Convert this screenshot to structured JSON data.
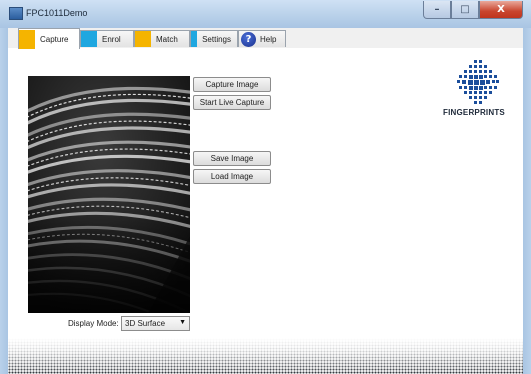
{
  "window": {
    "title": "FPC1011Demo",
    "controls": {
      "minimize": "–",
      "maximize": "□",
      "close": "X"
    }
  },
  "tabs": [
    {
      "label": "Capture",
      "color": "#f5b400",
      "active": true
    },
    {
      "label": "Enrol",
      "color": "#1fa7e0",
      "active": false
    },
    {
      "label": "Match",
      "color": "#f5b400",
      "active": false
    },
    {
      "label": "Settings",
      "color": "#1fa7e0",
      "active": false
    },
    {
      "label": "Help",
      "icon": "help-icon",
      "active": false
    }
  ],
  "buttons": {
    "capture_image": "Capture Image",
    "start_live_capture": "Start Live Capture",
    "save_image": "Save Image",
    "load_image": "Load Image"
  },
  "display_mode": {
    "label": "Display Mode:",
    "selected": "3D Surface"
  },
  "logo": {
    "word": "FINGERPRINTS",
    "icon": "fingerprints-logo-icon"
  },
  "image": {
    "icon": "fingerprint-3d-surface-image"
  }
}
